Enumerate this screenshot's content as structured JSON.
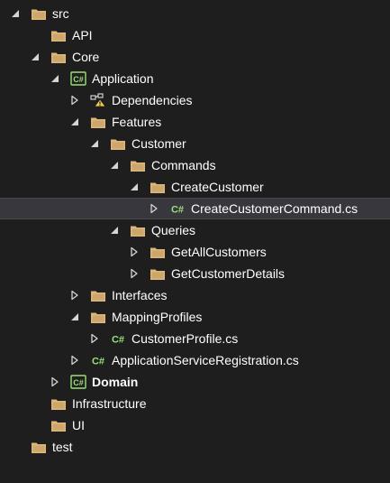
{
  "tree": [
    {
      "label": "src",
      "depth": 0,
      "chevron": "expanded",
      "icon": "folder",
      "selected": false,
      "bold": false
    },
    {
      "label": "API",
      "depth": 1,
      "chevron": "none",
      "icon": "folder",
      "selected": false,
      "bold": false
    },
    {
      "label": "Core",
      "depth": 1,
      "chevron": "expanded",
      "icon": "folder",
      "selected": false,
      "bold": false
    },
    {
      "label": "Application",
      "depth": 2,
      "chevron": "expanded",
      "icon": "csproj",
      "selected": false,
      "bold": false
    },
    {
      "label": "Dependencies",
      "depth": 3,
      "chevron": "collapsed",
      "icon": "dependencies-warning",
      "selected": false,
      "bold": false
    },
    {
      "label": "Features",
      "depth": 3,
      "chevron": "expanded",
      "icon": "folder",
      "selected": false,
      "bold": false
    },
    {
      "label": "Customer",
      "depth": 4,
      "chevron": "expanded",
      "icon": "folder",
      "selected": false,
      "bold": false
    },
    {
      "label": "Commands",
      "depth": 5,
      "chevron": "expanded",
      "icon": "folder",
      "selected": false,
      "bold": false
    },
    {
      "label": "CreateCustomer",
      "depth": 6,
      "chevron": "expanded",
      "icon": "folder",
      "selected": false,
      "bold": false
    },
    {
      "label": "CreateCustomerCommand.cs",
      "depth": 7,
      "chevron": "collapsed",
      "icon": "csharp-file",
      "selected": true,
      "bold": false
    },
    {
      "label": "Queries",
      "depth": 5,
      "chevron": "expanded",
      "icon": "folder",
      "selected": false,
      "bold": false
    },
    {
      "label": "GetAllCustomers",
      "depth": 6,
      "chevron": "collapsed",
      "icon": "folder",
      "selected": false,
      "bold": false
    },
    {
      "label": "GetCustomerDetails",
      "depth": 6,
      "chevron": "collapsed",
      "icon": "folder",
      "selected": false,
      "bold": false
    },
    {
      "label": "Interfaces",
      "depth": 3,
      "chevron": "collapsed",
      "icon": "folder",
      "selected": false,
      "bold": false
    },
    {
      "label": "MappingProfiles",
      "depth": 3,
      "chevron": "expanded",
      "icon": "folder",
      "selected": false,
      "bold": false
    },
    {
      "label": "CustomerProfile.cs",
      "depth": 4,
      "chevron": "collapsed",
      "icon": "csharp-file",
      "selected": false,
      "bold": false
    },
    {
      "label": "ApplicationServiceRegistration.cs",
      "depth": 3,
      "chevron": "collapsed",
      "icon": "csharp-file",
      "selected": false,
      "bold": false
    },
    {
      "label": "Domain",
      "depth": 2,
      "chevron": "collapsed",
      "icon": "csproj",
      "selected": false,
      "bold": true
    },
    {
      "label": "Infrastructure",
      "depth": 1,
      "chevron": "none",
      "icon": "folder",
      "selected": false,
      "bold": false
    },
    {
      "label": "UI",
      "depth": 1,
      "chevron": "none",
      "icon": "folder",
      "selected": false,
      "bold": false
    },
    {
      "label": "test",
      "depth": 0,
      "chevron": "none",
      "icon": "folder",
      "selected": false,
      "bold": false
    }
  ],
  "colors": {
    "background": "#1e1e1e",
    "selected_row": "#37373d",
    "text": "#ffffff",
    "chevron": "#d4d4d4",
    "folder": "#dcb67a",
    "csharp": "#9bdf7a",
    "warning": "#f2c94c"
  }
}
